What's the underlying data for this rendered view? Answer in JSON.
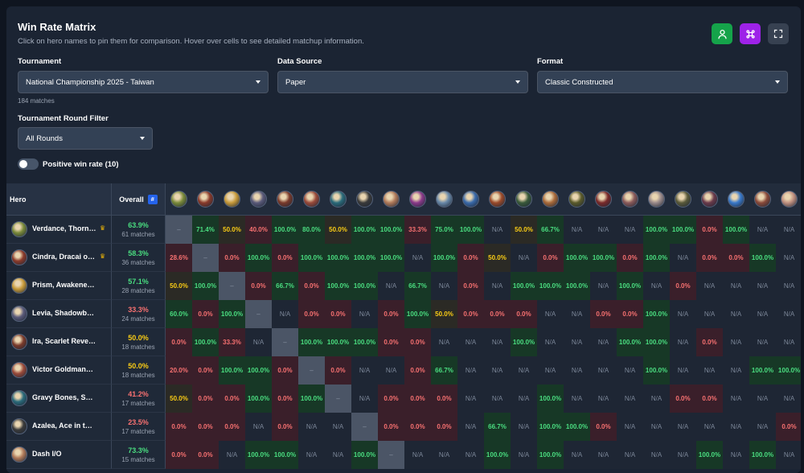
{
  "header": {
    "title": "Win Rate Matrix",
    "subtitle": "Click on hero names to pin them for comparison. Hover over cells to see detailed matchup information."
  },
  "toolbar": {
    "buttons": [
      {
        "icon": "user-icon",
        "color": "#15a34a"
      },
      {
        "icon": "command-icon",
        "color": "#9e22e8"
      },
      {
        "icon": "expand-icon",
        "color": "#374151"
      }
    ]
  },
  "filters": {
    "tournament": {
      "label": "Tournament",
      "value": "National Championship 2025 - Taiwan"
    },
    "matches_note": "184 matches",
    "source": {
      "label": "Data Source",
      "value": "Paper"
    },
    "format": {
      "label": "Format",
      "value": "Classic Constructed"
    },
    "round": {
      "label": "Tournament Round Filter",
      "value": "All Rounds"
    },
    "toggle": {
      "label": "Positive win rate (10)",
      "on": false
    }
  },
  "matrix": {
    "hero_header": "Hero",
    "overall_header": "Overall",
    "overall_badge": "#",
    "column_icon_colors": [
      "#7a8a3a",
      "#8a3a2a",
      "#c79a3a",
      "#5a5a7a",
      "#7a3a2a",
      "#9a4a3a",
      "#2a6a7a",
      "#3a3a3a",
      "#b07a5a",
      "#8a3a8a",
      "#6a8aaa",
      "#3a6aaa",
      "#9a4a2a",
      "#3a5a3a",
      "#aa6a3a",
      "#5a5a2a",
      "#7a2a2a",
      "#8a5a5a",
      "#9a8a8a",
      "#5a5a3a",
      "#6a3a4a",
      "#3a7acb",
      "#8a4a3a",
      "#c09080"
    ],
    "rows": [
      {
        "name": "Verdance, Thorn of the Rose",
        "pinned": true,
        "overall": "63.9%",
        "matches": "61 matches",
        "overall_color": "#4ade80",
        "icon_color": "#7a8a3a",
        "cells": [
          "–",
          "71.4%",
          "50.0%",
          "40.0%",
          "100.0%",
          "80.0%",
          "50.0%",
          "100.0%",
          "100.0%",
          "33.3%",
          "75.0%",
          "100.0%",
          "N/A",
          "50.0%",
          "66.7%",
          "N/A",
          "N/A",
          "N/A",
          "100.0%",
          "100.0%",
          "0.0%",
          "100.0%",
          "N/A",
          "N/A"
        ]
      },
      {
        "name": "Cindra, Dracai of Retribution",
        "pinned": true,
        "overall": "58.3%",
        "matches": "36 matches",
        "overall_color": "#4ade80",
        "icon_color": "#8a3a2a",
        "cells": [
          "28.6%",
          "–",
          "0.0%",
          "100.0%",
          "0.0%",
          "100.0%",
          "100.0%",
          "100.0%",
          "100.0%",
          "N/A",
          "100.0%",
          "0.0%",
          "50.0%",
          "N/A",
          "0.0%",
          "100.0%",
          "100.0%",
          "0.0%",
          "100.0%",
          "N/A",
          "0.0%",
          "0.0%",
          "100.0%",
          "N/A"
        ]
      },
      {
        "name": "Prism, Awakener of Sol",
        "pinned": false,
        "overall": "57.1%",
        "matches": "28 matches",
        "overall_color": "#4ade80",
        "icon_color": "#c79a3a",
        "cells": [
          "50.0%",
          "100.0%",
          "–",
          "0.0%",
          "66.7%",
          "0.0%",
          "100.0%",
          "100.0%",
          "N/A",
          "66.7%",
          "N/A",
          "0.0%",
          "N/A",
          "100.0%",
          "100.0%",
          "100.0%",
          "N/A",
          "100.0%",
          "N/A",
          "0.0%",
          "N/A",
          "N/A",
          "N/A",
          "N/A"
        ]
      },
      {
        "name": "Levia, Shadowborn Abomination",
        "pinned": false,
        "overall": "33.3%",
        "matches": "24 matches",
        "overall_color": "#f87171",
        "icon_color": "#5a5a7a",
        "cells": [
          "60.0%",
          "0.0%",
          "100.0%",
          "–",
          "N/A",
          "0.0%",
          "0.0%",
          "N/A",
          "0.0%",
          "100.0%",
          "50.0%",
          "0.0%",
          "0.0%",
          "0.0%",
          "N/A",
          "N/A",
          "0.0%",
          "0.0%",
          "100.0%",
          "N/A",
          "N/A",
          "N/A",
          "N/A",
          "N/A"
        ]
      },
      {
        "name": "Ira, Scarlet Revenger",
        "pinned": false,
        "overall": "50.0%",
        "matches": "18 matches",
        "overall_color": "#facc15",
        "icon_color": "#7a3a2a",
        "cells": [
          "0.0%",
          "100.0%",
          "33.3%",
          "N/A",
          "–",
          "100.0%",
          "100.0%",
          "100.0%",
          "0.0%",
          "0.0%",
          "N/A",
          "N/A",
          "N/A",
          "100.0%",
          "N/A",
          "N/A",
          "N/A",
          "100.0%",
          "100.0%",
          "N/A",
          "0.0%",
          "N/A",
          "N/A",
          "N/A"
        ]
      },
      {
        "name": "Victor Goldmane, High and Mighty",
        "pinned": false,
        "overall": "50.0%",
        "matches": "18 matches",
        "overall_color": "#facc15",
        "icon_color": "#9a4a3a",
        "cells": [
          "20.0%",
          "0.0%",
          "100.0%",
          "100.0%",
          "0.0%",
          "–",
          "0.0%",
          "N/A",
          "N/A",
          "0.0%",
          "66.7%",
          "N/A",
          "N/A",
          "N/A",
          "N/A",
          "N/A",
          "N/A",
          "N/A",
          "100.0%",
          "N/A",
          "N/A",
          "N/A",
          "100.0%",
          "100.0%"
        ]
      },
      {
        "name": "Gravy Bones, Shipwrecked Looter",
        "pinned": false,
        "overall": "41.2%",
        "matches": "17 matches",
        "overall_color": "#f87171",
        "icon_color": "#2a6a7a",
        "cells": [
          "50.0%",
          "0.0%",
          "0.0%",
          "100.0%",
          "0.0%",
          "100.0%",
          "–",
          "N/A",
          "0.0%",
          "0.0%",
          "0.0%",
          "N/A",
          "N/A",
          "N/A",
          "100.0%",
          "N/A",
          "N/A",
          "N/A",
          "N/A",
          "0.0%",
          "0.0%",
          "N/A",
          "N/A",
          "N/A"
        ]
      },
      {
        "name": "Azalea, Ace in the Hole",
        "pinned": false,
        "overall": "23.5%",
        "matches": "17 matches",
        "overall_color": "#f87171",
        "icon_color": "#3a3a3a",
        "cells": [
          "0.0%",
          "0.0%",
          "0.0%",
          "N/A",
          "0.0%",
          "N/A",
          "N/A",
          "–",
          "0.0%",
          "0.0%",
          "0.0%",
          "N/A",
          "66.7%",
          "N/A",
          "100.0%",
          "100.0%",
          "0.0%",
          "N/A",
          "N/A",
          "N/A",
          "N/A",
          "N/A",
          "N/A",
          "0.0%"
        ]
      },
      {
        "name": "Dash I/O",
        "pinned": false,
        "overall": "73.3%",
        "matches": "15 matches",
        "overall_color": "#4ade80",
        "icon_color": "#b07a5a",
        "cells": [
          "0.0%",
          "0.0%",
          "N/A",
          "100.0%",
          "100.0%",
          "N/A",
          "N/A",
          "100.0%",
          "–",
          "N/A",
          "N/A",
          "N/A",
          "100.0%",
          "N/A",
          "100.0%",
          "N/A",
          "N/A",
          "N/A",
          "N/A",
          "N/A",
          "100.0%",
          "N/A",
          "100.0%",
          "N/A"
        ]
      }
    ]
  }
}
